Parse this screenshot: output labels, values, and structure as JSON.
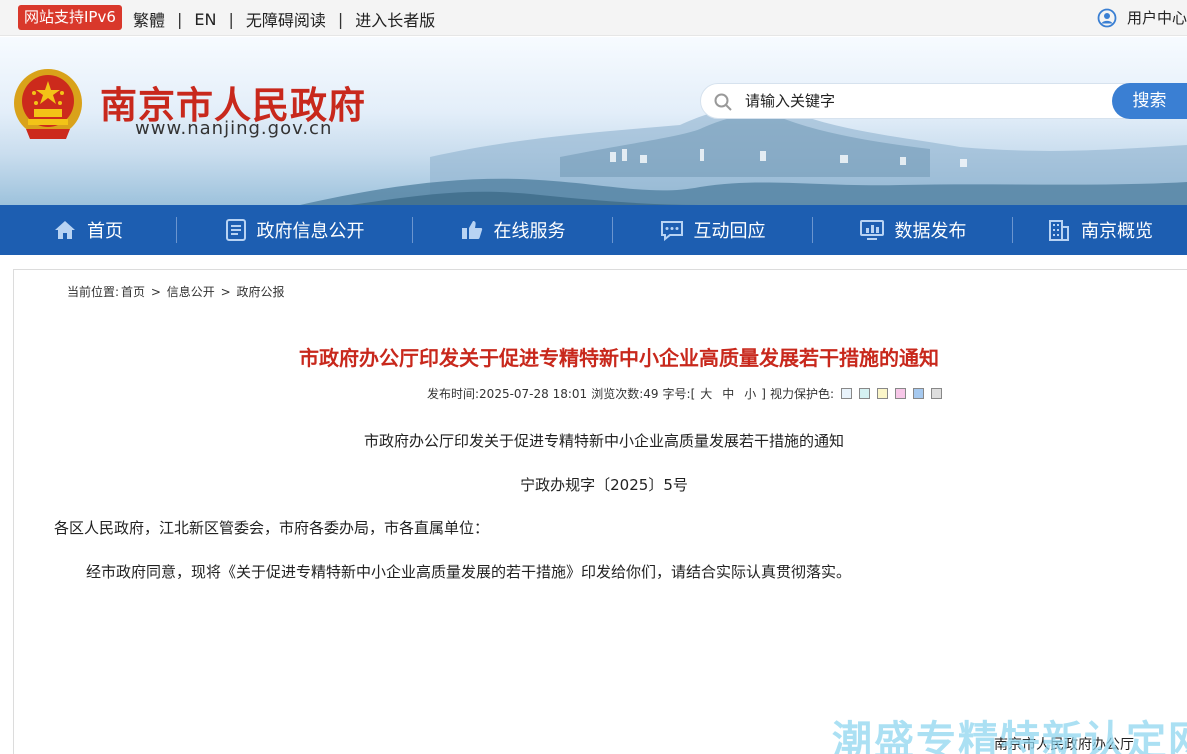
{
  "topbar": {
    "ipv6_badge": "网站支持IPv6",
    "links": [
      "繁體",
      "EN",
      "无障碍阅读",
      "进入长者版"
    ],
    "separator": "|",
    "user_center": "用户中心"
  },
  "header": {
    "site_name": "南京市人民政府",
    "site_url": "www.nanjing.gov.cn",
    "search_placeholder": "请输入关键字",
    "search_button": "搜索"
  },
  "nav": {
    "items": [
      {
        "label": "首页",
        "icon": "home-icon"
      },
      {
        "label": "政府信息公开",
        "icon": "document-icon"
      },
      {
        "label": "在线服务",
        "icon": "thumbs-up-icon"
      },
      {
        "label": "互动回应",
        "icon": "chat-icon"
      },
      {
        "label": "数据发布",
        "icon": "monitor-chart-icon"
      },
      {
        "label": "南京概览",
        "icon": "building-icon"
      }
    ]
  },
  "breadcrumb": {
    "prefix": "当前位置:",
    "items": [
      "首页",
      "信息公开",
      "政府公报"
    ],
    "separator": ">"
  },
  "article": {
    "title": "市政府办公厅印发关于促进专精特新中小企业高质量发展若干措施的通知",
    "meta": {
      "publish_label": "发布时间:",
      "publish_time": "2025-07-28 18:01",
      "views_label": "浏览次数:",
      "views": "49",
      "fontsize_label": "字号:",
      "font_open": "[",
      "font_sizes": [
        "大",
        "中",
        "小"
      ],
      "font_close": "]",
      "eye_label": "视力保护色:",
      "eye_colors": [
        "#e9f3fb",
        "#d5f1f2",
        "#fbf6c9",
        "#f7c7e8",
        "#a6c9ef",
        "#dedede"
      ]
    },
    "doc_title": "市政府办公厅印发关于促进专精特新中小企业高质量发展若干措施的通知",
    "doc_number": "宁政办规字〔2025〕5号",
    "addressee": "各区人民政府，江北新区管委会，市府各委办局，市各直属单位：",
    "paragraph": "经市政府同意，现将《关于促进专精特新中小企业高质量发展的若干措施》印发给你们，请结合实际认真贯彻落实。",
    "signer": "南京市人民政府办公厅"
  },
  "watermark": "潮盛专精特新认定网",
  "colors": {
    "accent_red": "#c8281c",
    "nav_blue": "#1d5eb1",
    "search_blue": "#3a7fd3"
  }
}
